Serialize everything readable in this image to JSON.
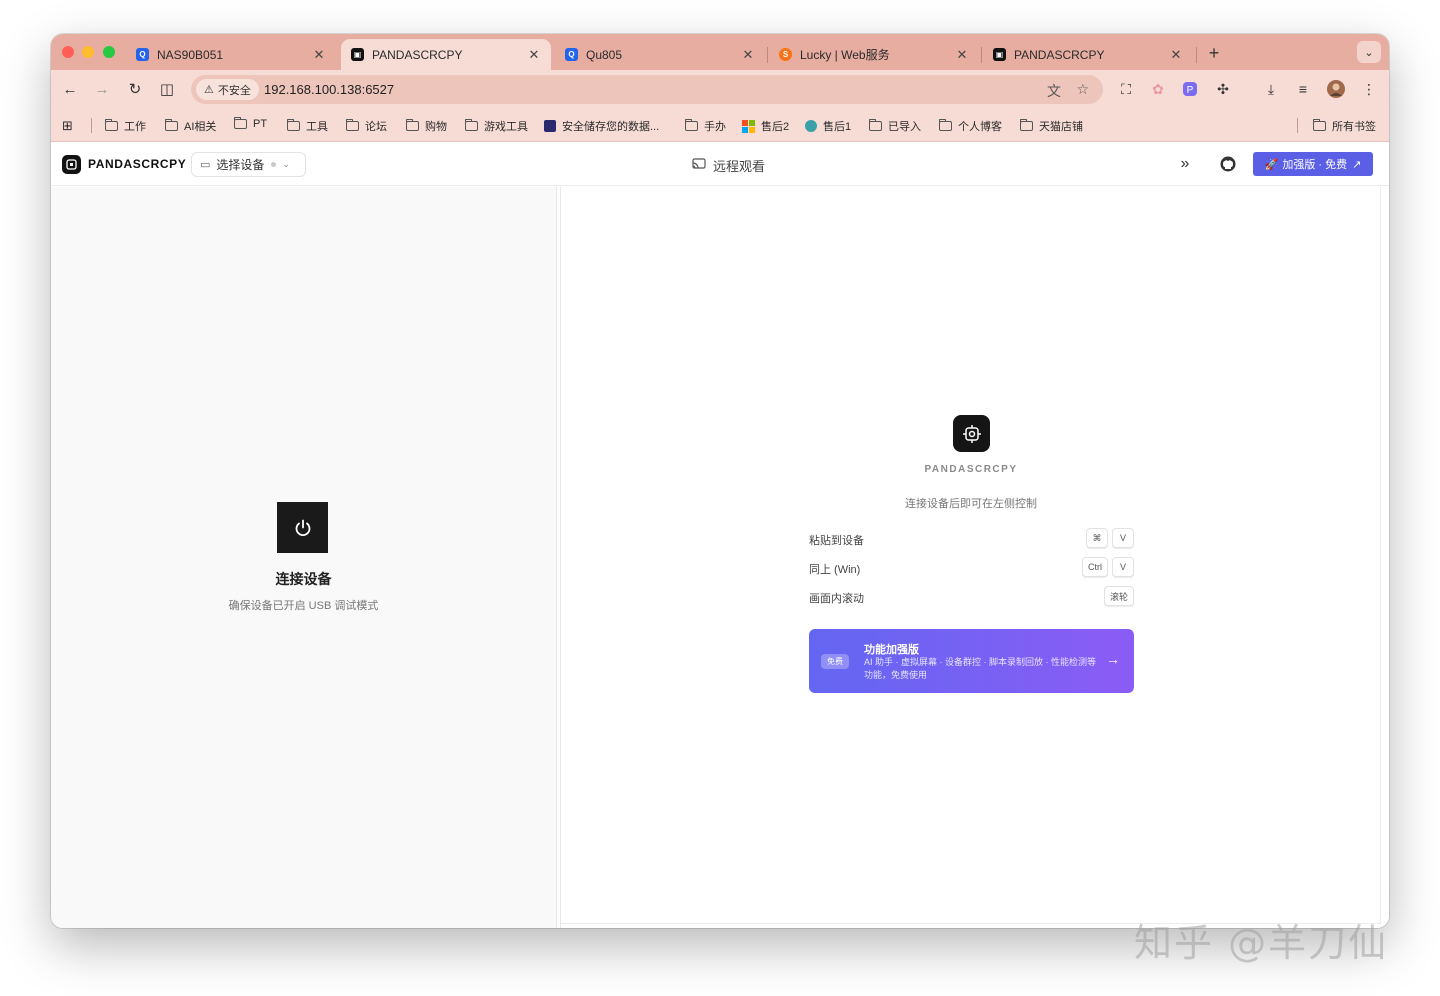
{
  "tabs": [
    {
      "title": "NAS90B051",
      "favicon_color": "#2563eb",
      "active": false
    },
    {
      "title": "PANDASCRCPY",
      "favicon_color": "#111111",
      "active": true
    },
    {
      "title": "Qu805",
      "favicon_color": "#2563eb",
      "active": false
    },
    {
      "title": "Lucky | Web服务",
      "favicon_color": "#f97316",
      "active": false
    },
    {
      "title": "PANDASCRCPY",
      "favicon_color": "#111111",
      "active": false
    }
  ],
  "toolbar": {
    "security_label": "不安全",
    "url": "192.168.100.138:6527"
  },
  "bookmarks": [
    {
      "label": "工作",
      "icon": "folder-icon"
    },
    {
      "label": "AI相关",
      "icon": "folder-icon"
    },
    {
      "label": "PT",
      "icon": "folder-icon"
    },
    {
      "label": "工具",
      "icon": "folder-icon"
    },
    {
      "label": "论坛",
      "icon": "folder-icon"
    },
    {
      "label": "购物",
      "icon": "folder-icon"
    },
    {
      "label": "游戏工具",
      "icon": "folder-icon"
    },
    {
      "label": "安全储存您的数据...",
      "icon": "site-icon"
    },
    {
      "label": "手办",
      "icon": "folder-icon"
    },
    {
      "label": "售后2",
      "icon": "microsoft-icon"
    },
    {
      "label": "售后1",
      "icon": "site-icon"
    },
    {
      "label": "已导入",
      "icon": "folder-icon"
    },
    {
      "label": "个人博客",
      "icon": "folder-icon"
    },
    {
      "label": "天猫店铺",
      "icon": "folder-icon"
    },
    {
      "label": "所有书签",
      "icon": "folder-icon"
    }
  ],
  "app": {
    "brand": "PANDASCRCPY",
    "device_select": "选择设备",
    "center_title": "远程观看",
    "pro_button": "加强版 · 免费",
    "left": {
      "title": "连接设备",
      "subtitle": "确保设备已开启 USB 调试模式"
    },
    "right": {
      "brand": "PANDASCRCPY",
      "hint": "连接设备后即可在左侧控制",
      "shortcuts": [
        {
          "label": "粘贴到设备",
          "keys": [
            "⌘",
            "V"
          ]
        },
        {
          "label": "同上 (Win)",
          "keys": [
            "Ctrl",
            "V"
          ]
        },
        {
          "label": "画面内滚动",
          "keys": [
            "滚轮"
          ]
        }
      ],
      "promo": {
        "badge": "免费",
        "title": "功能加强版",
        "desc": "AI 助手 · 虚拟屏幕 · 设备群控 · 脚本录制回放 · 性能检测等功能，免费使用"
      }
    }
  },
  "watermark": "知乎 @羊刀仙",
  "colors": {
    "tab_strip": "#e6ada0",
    "toolbar": "#f7dcd5",
    "accent": "#5a5fe6"
  }
}
